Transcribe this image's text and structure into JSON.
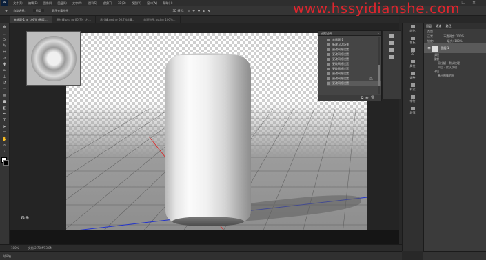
{
  "window": {
    "app_logo": "Ps",
    "menu": [
      "文件(F)",
      "编辑(E)",
      "图像(I)",
      "图层(L)",
      "文字(Y)",
      "选择(S)",
      "滤镜(T)",
      "3D(D)",
      "视图(V)",
      "窗口(W)",
      "帮助(H)"
    ],
    "controls": "– ❐ ✕",
    "watermark": "www.hssyidianshe.com"
  },
  "options_bar": {
    "items": [
      "自动选择:",
      "图层",
      "显示变换控件",
      "3D 模式:"
    ]
  },
  "tabs": [
    {
      "label": "未标题-1 @ 100% (图层...",
      "active": true
    },
    {
      "label": "易拉罐.psd @ 66.7% (右...",
      "active": false
    },
    {
      "label": "易拉罐.psd @ 66.7% (罐...",
      "active": false
    },
    {
      "label": "纹理贴图.psd @ 100%...",
      "active": false
    }
  ],
  "tools": [
    "move-icon",
    "marquee-icon",
    "lasso-icon",
    "quick-select-icon",
    "crop-icon",
    "eyedropper-icon",
    "healing-icon",
    "brush-icon",
    "stamp-icon",
    "history-brush-icon",
    "eraser-icon",
    "gradient-icon",
    "blur-icon",
    "dodge-icon",
    "pen-icon",
    "type-icon",
    "path-select-icon",
    "shape-icon",
    "hand-icon",
    "zoom-icon"
  ],
  "history_panel": {
    "title": "历史记录",
    "items": [
      "未标题-1",
      "新建 3D 场景",
      "更改网格设置",
      "更改网格设置",
      "更改网格设置",
      "更改网格设置",
      "更改网格设置",
      "更改网格设置",
      "更改网格设置",
      "更改网格设置"
    ],
    "selected_index": 9
  },
  "panel_column": {
    "items": [
      "颜色",
      "色板",
      "3D",
      "属性",
      "调整",
      "样式",
      "字符",
      "段落"
    ]
  },
  "layers_panel": {
    "tabs": [
      "图层",
      "通道",
      "路径"
    ],
    "kind_filter": "类型",
    "blend_mode": "正常",
    "opacity": "不透明度: 100%",
    "lock": "锁定:",
    "fill": "填充: 100%",
    "layer_name": "图层 1",
    "sub_items": [
      "纹理",
      "漫射",
      "易拉罐 - 默认纹理",
      "凹凸 - 默认纹理",
      "环境",
      "基于图像的光"
    ]
  },
  "status": {
    "zoom": "100%",
    "doc": "文档:2.78M/13.8M"
  },
  "timeline": {
    "label": "时间轴"
  }
}
